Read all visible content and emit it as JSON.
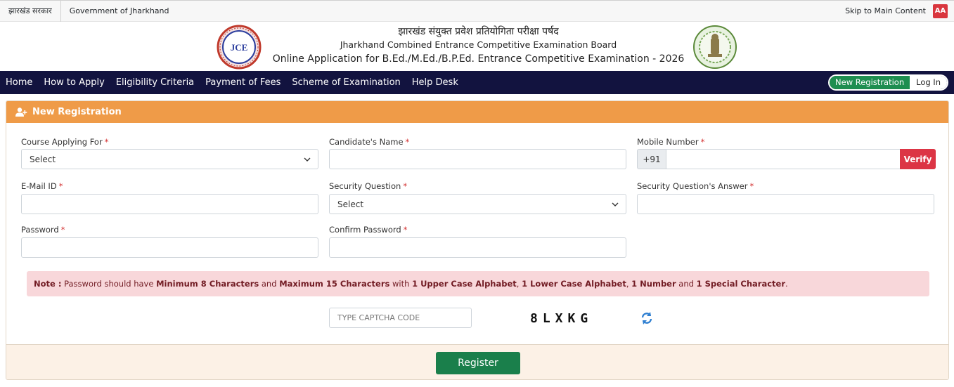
{
  "topbar": {
    "gov_hindi": "झारखंड सरकार",
    "gov_english": "Government of Jharkhand",
    "skip": "Skip to Main Content",
    "aa": "AA"
  },
  "header": {
    "hindi_title": "झारखंड संयुक्त प्रवेश प्रतियोगिता परीक्षा पर्षद",
    "english_title": "Jharkhand Combined Entrance Competitive Examination Board",
    "online_title": "Online Application for B.Ed./M.Ed./B.P.Ed. Entrance Competitive Examination - 2026",
    "logo_text": "JCE"
  },
  "nav": {
    "items": [
      "Home",
      "How to Apply",
      "Eligibility Criteria",
      "Payment of Fees",
      "Scheme of Examination",
      "Help Desk"
    ],
    "new_registration": "New Registration",
    "login": "Log In"
  },
  "card": {
    "title": "New Registration"
  },
  "form": {
    "course_label": "Course Applying For",
    "course_value": "Select",
    "name_label": "Candidate's Name",
    "name_value": "",
    "mobile_label": "Mobile Number",
    "mobile_prefix": "+91",
    "mobile_value": "",
    "verify": "Verify",
    "email_label": "E-Mail ID",
    "email_value": "",
    "sq_label": "Security Question",
    "sq_value": "Select",
    "sqa_label": "Security Question's Answer",
    "sqa_value": "",
    "password_label": "Password",
    "password_value": "",
    "confirm_label": "Confirm Password",
    "confirm_value": "",
    "required_mark": "*"
  },
  "note": {
    "prefix": "Note :",
    "t1": " Password should have ",
    "b1": "Minimum 8 Characters",
    "t2": " and ",
    "b2": "Maximum 15 Characters",
    "t3": " with ",
    "b3": "1 Upper Case Alphabet",
    "t4": ", ",
    "b4": "1 Lower Case Alphabet",
    "t5": ", ",
    "b5": "1 Number",
    "t6": " and ",
    "b6": "1 Special Character",
    "t7": "."
  },
  "captcha": {
    "placeholder": "TYPE CAPTCHA CODE",
    "code": "8LXKG"
  },
  "footer": {
    "register": "Register"
  },
  "colors": {
    "nav_bg": "#12133f",
    "card_head": "#ef9b48",
    "register": "#1a7f4b",
    "verify": "#dc3545"
  }
}
